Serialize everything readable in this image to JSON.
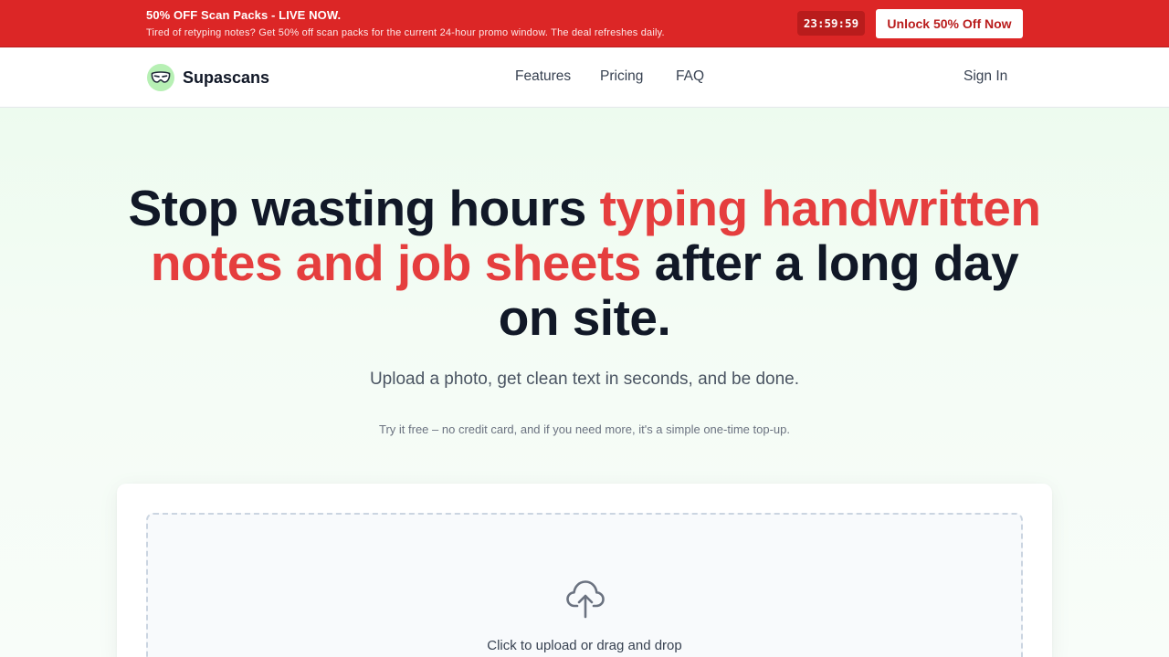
{
  "promo": {
    "title": "50% OFF Scan Packs - LIVE NOW.",
    "subtitle": "Tired of retyping notes? Get 50% off scan packs for the current 24-hour promo window. The deal refreshes daily.",
    "timer": "23:59:59",
    "cta_label": "Unlock 50% Off Now",
    "color": "#dc2626"
  },
  "nav": {
    "brand": "Supascans",
    "brand_icon": "mask-icon",
    "links": [
      "Features",
      "Pricing",
      "FAQ"
    ],
    "sign_in": "Sign In"
  },
  "hero": {
    "headline_part1": "Stop wasting hours ",
    "headline_accent": "typing handwritten notes and job sheets",
    "headline_part2": " after a long day on site.",
    "accent_color": "#e53e3e",
    "subheadline": "Upload a photo, get clean text in seconds, and be done.",
    "note": "Try it free – no credit card, and if you need more, it's a simple one-time top-up."
  },
  "upload": {
    "icon": "cloud-upload-icon",
    "label": "Click to upload or drag and drop"
  }
}
